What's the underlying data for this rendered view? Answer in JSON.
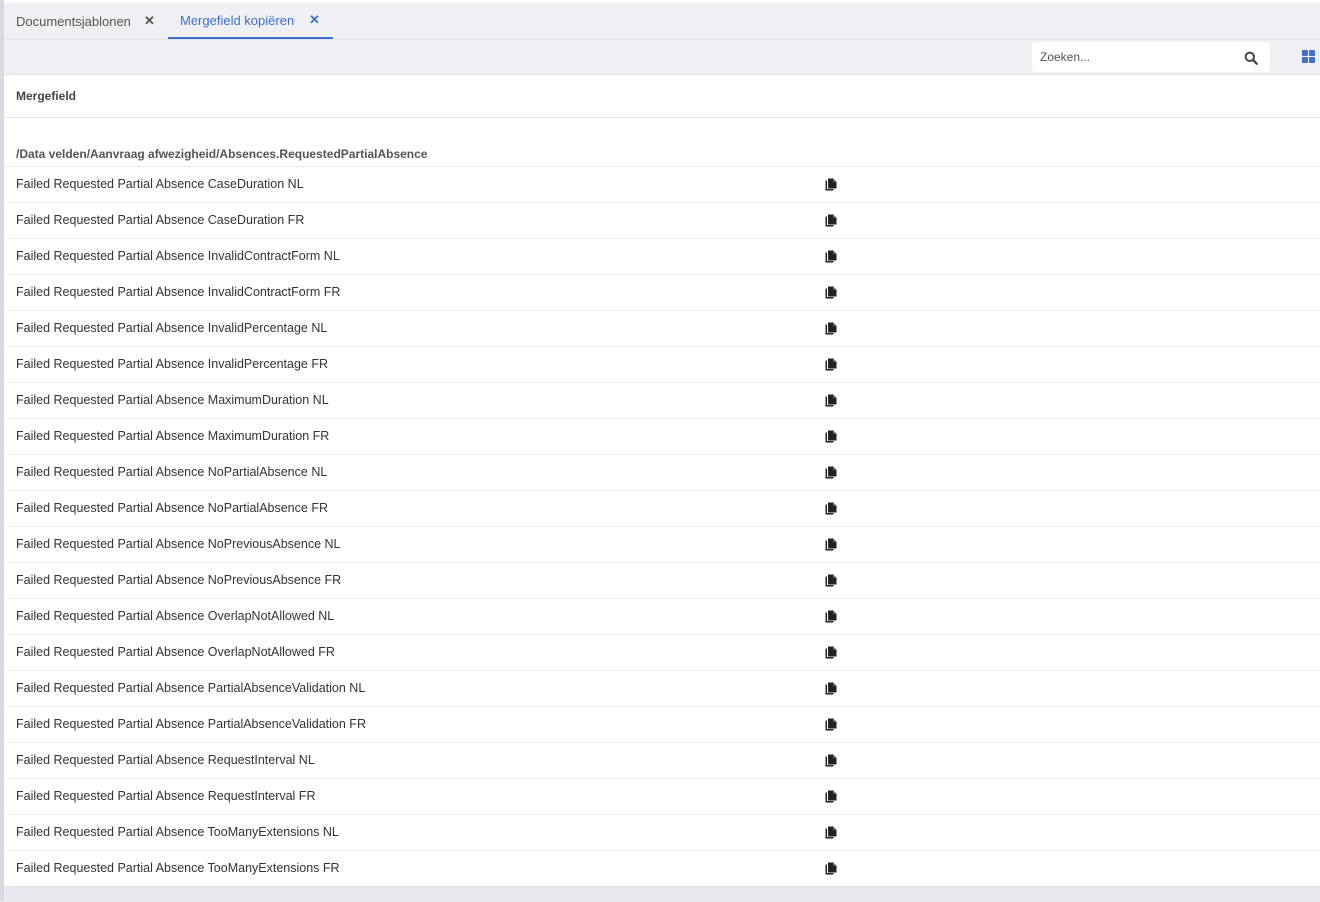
{
  "tabs": [
    {
      "label": "Documentsjablonen",
      "active": false
    },
    {
      "label": "Mergefield kopiëren",
      "active": true
    }
  ],
  "search": {
    "placeholder": "Zoeken...",
    "value": ""
  },
  "icons": {
    "search": "search-icon",
    "view_toggle": "grid-view-icon",
    "copy": "copy-icon",
    "close": "close-icon"
  },
  "colors": {
    "accent": "#3f6fd1",
    "background": "#eef0f4"
  },
  "table": {
    "column_header": "Mergefield",
    "group_path": "/Data velden/Aanvraag afwezigheid/Absences.RequestedPartialAbsence",
    "rows": [
      "Failed Requested Partial Absence CaseDuration NL",
      "Failed Requested Partial Absence CaseDuration FR",
      "Failed Requested Partial Absence InvalidContractForm NL",
      "Failed Requested Partial Absence InvalidContractForm FR",
      "Failed Requested Partial Absence InvalidPercentage NL",
      "Failed Requested Partial Absence InvalidPercentage FR",
      "Failed Requested Partial Absence MaximumDuration NL",
      "Failed Requested Partial Absence MaximumDuration FR",
      "Failed Requested Partial Absence NoPartialAbsence NL",
      "Failed Requested Partial Absence NoPartialAbsence FR",
      "Failed Requested Partial Absence NoPreviousAbsence NL",
      "Failed Requested Partial Absence NoPreviousAbsence FR",
      "Failed Requested Partial Absence OverlapNotAllowed NL",
      "Failed Requested Partial Absence OverlapNotAllowed FR",
      "Failed Requested Partial Absence PartialAbsenceValidation NL",
      "Failed Requested Partial Absence PartialAbsenceValidation FR",
      "Failed Requested Partial Absence RequestInterval NL",
      "Failed Requested Partial Absence RequestInterval FR",
      "Failed Requested Partial Absence TooManyExtensions NL",
      "Failed Requested Partial Absence TooManyExtensions FR"
    ]
  }
}
